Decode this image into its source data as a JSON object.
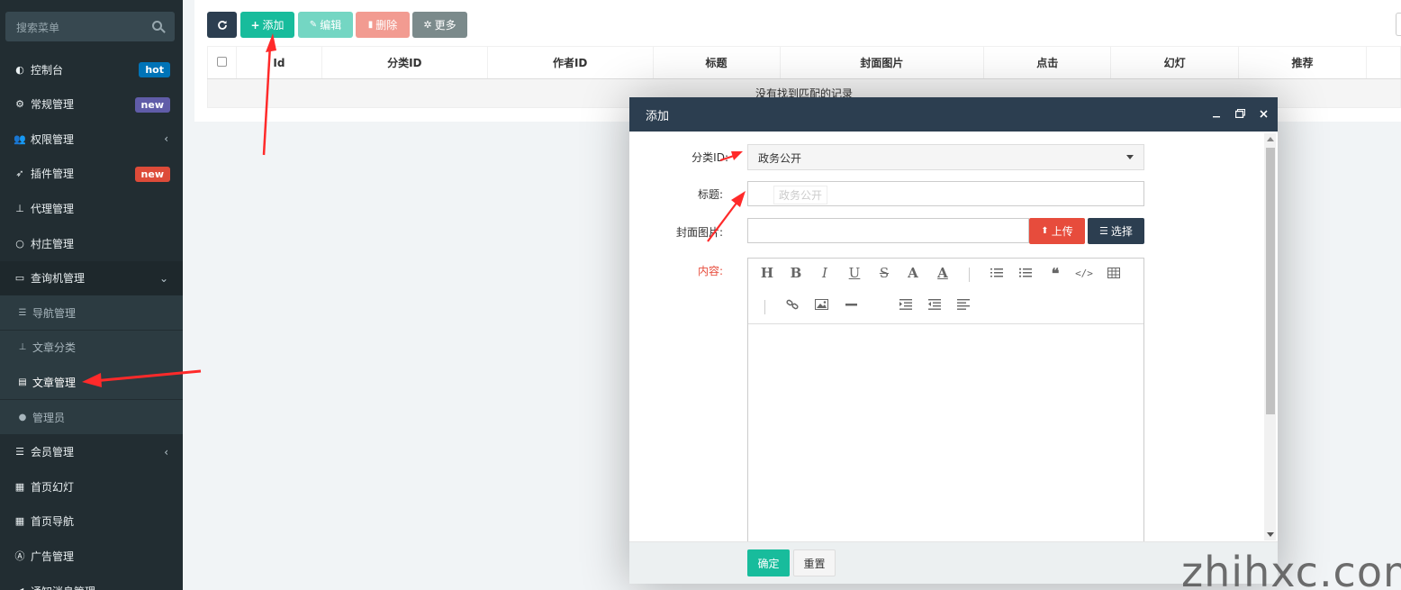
{
  "sidebar": {
    "search_placeholder": "搜索菜单",
    "items": [
      {
        "label": "控制台",
        "icon": "dashboard-icon",
        "badge": "hot",
        "badge_color": "#0073b7"
      },
      {
        "label": "常规管理",
        "icon": "cogs-icon",
        "badge": "new",
        "badge_color": "#605ca8"
      },
      {
        "label": "权限管理",
        "icon": "group-icon",
        "arrow": "‹"
      },
      {
        "label": "插件管理",
        "icon": "rocket-icon",
        "badge": "new",
        "badge_color": "#dd4b39"
      },
      {
        "label": "代理管理",
        "icon": "sitemap-icon"
      },
      {
        "label": "村庄管理",
        "icon": "circle-icon"
      },
      {
        "label": "查询机管理",
        "icon": "laptop-icon",
        "arrow": "⌄"
      }
    ],
    "subitems": [
      {
        "label": "导航管理",
        "icon": "list-icon"
      },
      {
        "label": "文章分类",
        "icon": "sitemap-icon"
      },
      {
        "label": "文章管理",
        "icon": "file-icon"
      },
      {
        "label": "管理员",
        "icon": "user-icon"
      }
    ],
    "items_after": [
      {
        "label": "会员管理",
        "icon": "list-icon",
        "arrow": "‹"
      },
      {
        "label": "首页幻灯",
        "icon": "film-icon"
      },
      {
        "label": "首页导航",
        "icon": "th-icon"
      },
      {
        "label": "广告管理",
        "icon": "ad-icon"
      },
      {
        "label": "通知消息管理",
        "icon": "bullhorn-icon"
      }
    ]
  },
  "toolbar": {
    "refresh_icon": "refresh-icon",
    "add_label": "添加",
    "edit_label": "编辑",
    "delete_label": "删除",
    "more_label": "更多",
    "colors": {
      "refresh": "#2c3e50",
      "add": "#18bc9c",
      "edit": "#74d6c3",
      "delete": "#f29b91",
      "more": "#7b8a8b"
    }
  },
  "table": {
    "columns": [
      "Id",
      "分类ID",
      "作者ID",
      "标题",
      "封面图片",
      "点击",
      "幻灯",
      "推荐"
    ],
    "empty_text": "没有找到匹配的记录"
  },
  "modal": {
    "title": "添加",
    "fields": {
      "category_label": "分类ID:",
      "category_value": "政务公开",
      "title_label": "标题:",
      "title_ghost": "政务公开",
      "cover_label": "封面图片:",
      "upload_label": "上传",
      "choose_label": "选择",
      "content_label": "内容:"
    },
    "editor_buttons": [
      "H",
      "B",
      "I",
      "U",
      "S",
      "A",
      "A"
    ],
    "footer": {
      "confirm_label": "确定",
      "reset_label": "重置"
    }
  },
  "watermark": "zhihxc.com"
}
